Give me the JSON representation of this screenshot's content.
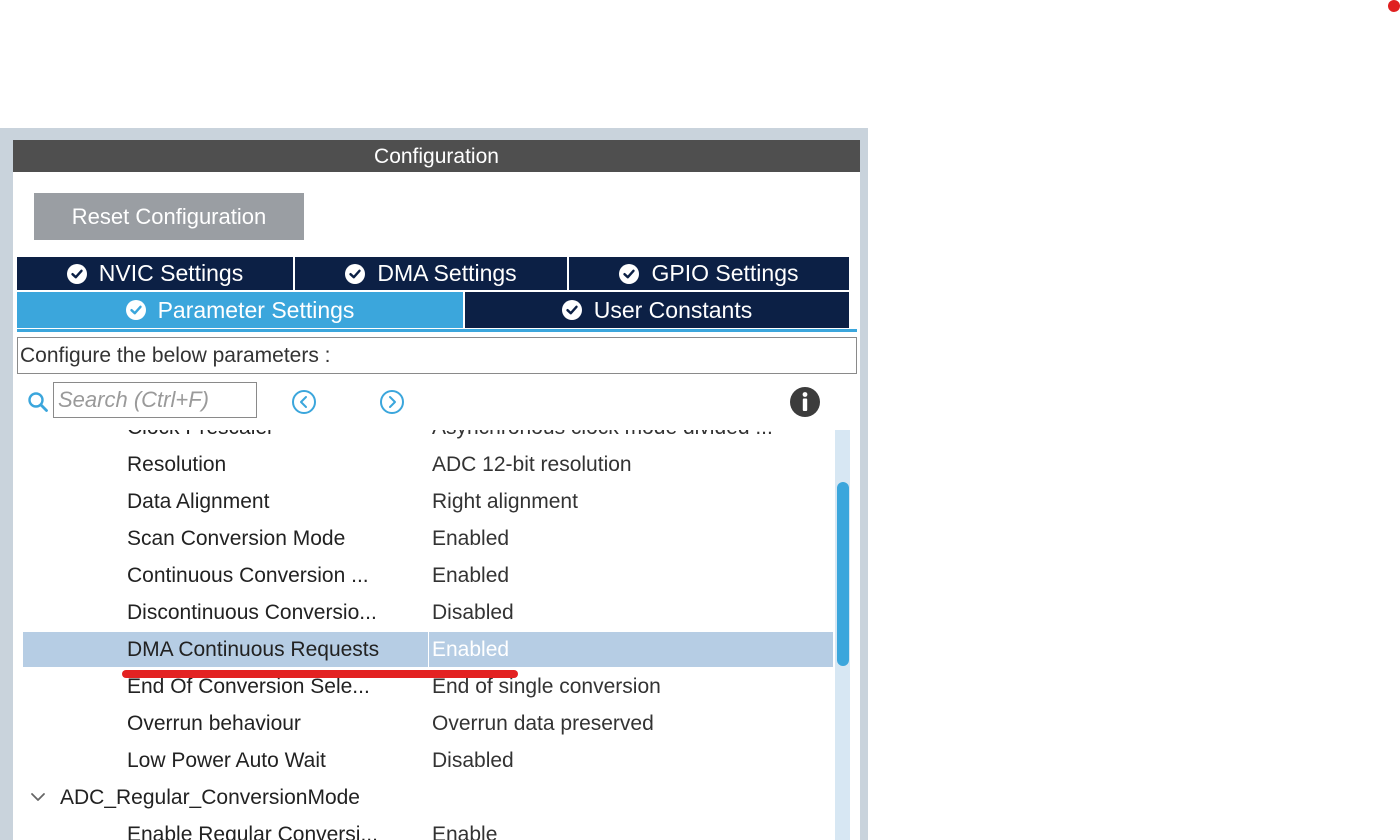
{
  "panel": {
    "title": "Configuration",
    "reset_label": "Reset Configuration"
  },
  "tabs": [
    {
      "label": "NVIC Settings",
      "active": false
    },
    {
      "label": "DMA Settings",
      "active": false
    },
    {
      "label": "GPIO Settings",
      "active": false
    },
    {
      "label": "Parameter Settings",
      "active": true
    },
    {
      "label": "User Constants",
      "active": false
    }
  ],
  "configure_text": "Configure the below parameters :",
  "search": {
    "placeholder": "Search (Ctrl+F)"
  },
  "icons": {
    "search": "search-icon",
    "previous": "chevron-left-circle-icon",
    "next": "chevron-right-circle-icon",
    "info": "info-icon",
    "tab_check": "check-circle-icon",
    "group_toggle": "chevron-down-icon"
  },
  "params": [
    {
      "name": "Clock Prescaler",
      "value": "Asynchronous clock mode divided ...",
      "selected": false
    },
    {
      "name": "Resolution",
      "value": "ADC 12-bit resolution",
      "selected": false
    },
    {
      "name": "Data Alignment",
      "value": "Right alignment",
      "selected": false
    },
    {
      "name": "Scan Conversion Mode",
      "value": "Enabled",
      "selected": false
    },
    {
      "name": "Continuous Conversion ...",
      "value": "Enabled",
      "selected": false
    },
    {
      "name": "Discontinuous Conversio...",
      "value": "Disabled",
      "selected": false
    },
    {
      "name": "DMA Continuous Requests",
      "value": "Enabled",
      "selected": true
    },
    {
      "name": "End Of Conversion Sele...",
      "value": "End of single conversion",
      "selected": false
    },
    {
      "name": "Overrun behaviour",
      "value": "Overrun data preserved",
      "selected": false
    },
    {
      "name": "Low Power Auto Wait",
      "value": "Disabled",
      "selected": false
    }
  ],
  "group": {
    "name": "ADC_Regular_ConversionMode"
  },
  "partial_param": {
    "name": "Enable Regular Conversi...",
    "value": "Enable"
  },
  "colors": {
    "title_bar": "#4f4f4f",
    "tab_dark": "#0c2045",
    "tab_active": "#3ba6dc",
    "selected_row": "#b6cde4",
    "annotation_red": "#e32222"
  }
}
